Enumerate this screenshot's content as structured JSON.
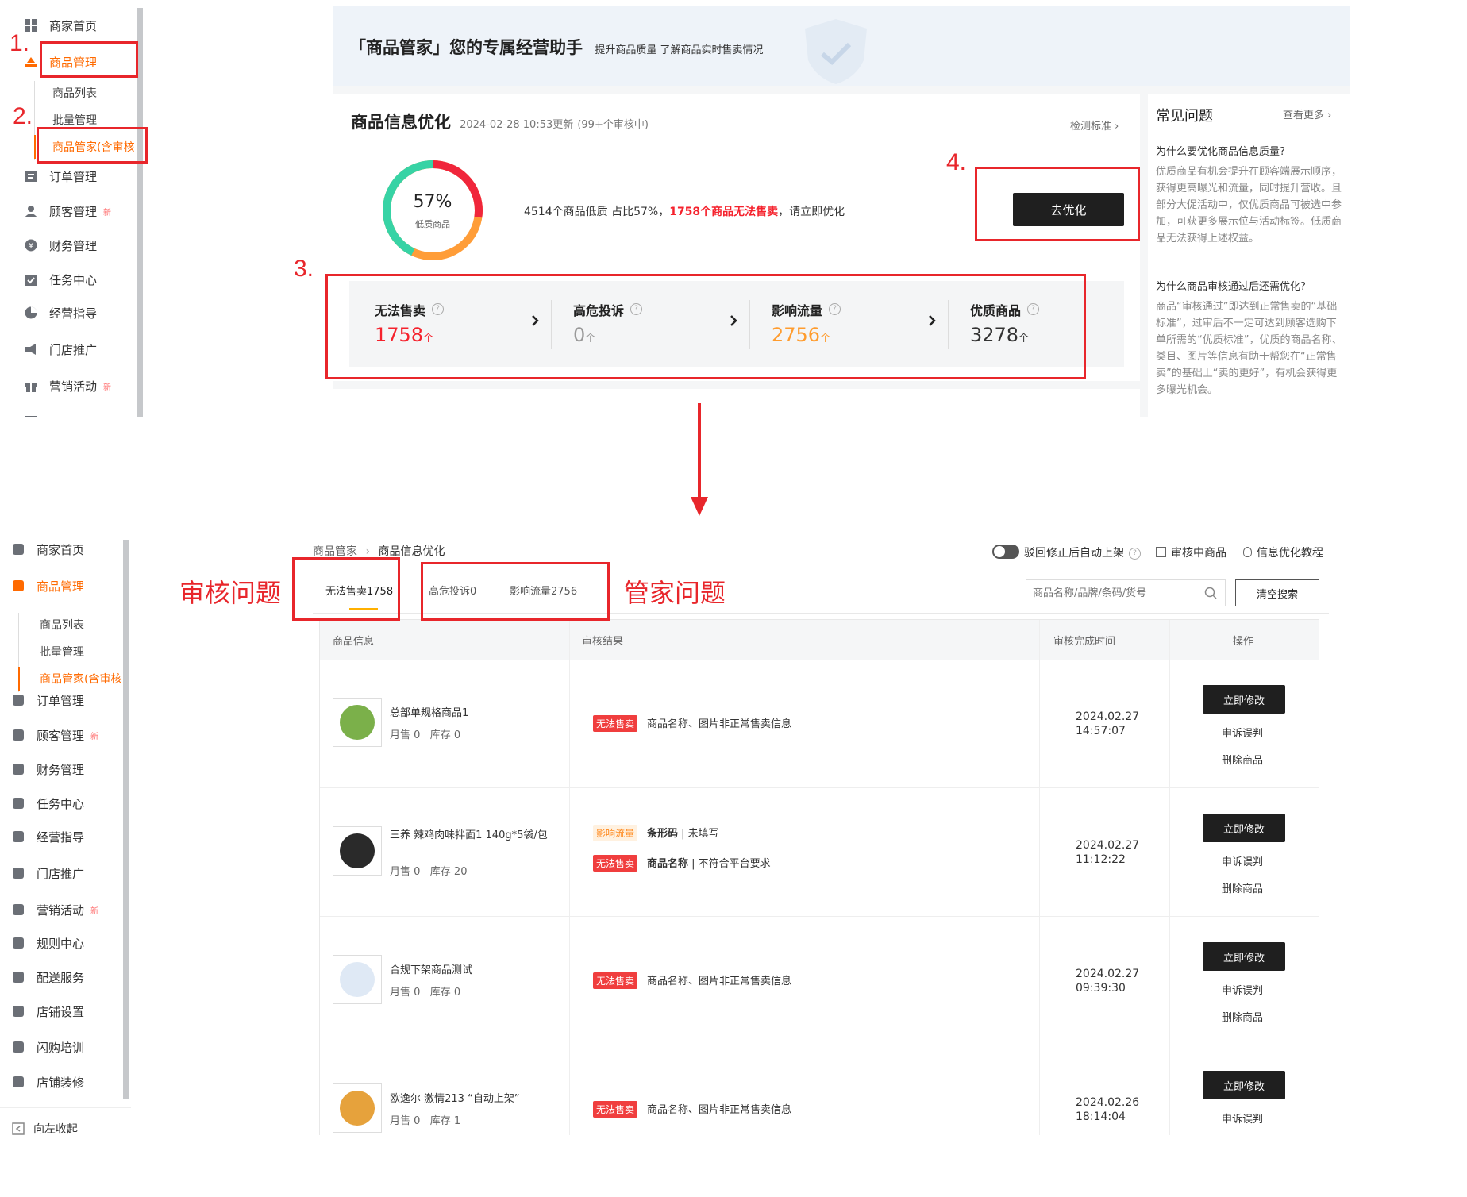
{
  "sidebar": {
    "items": [
      {
        "label": "商家首页"
      },
      {
        "label": "商品管理"
      },
      {
        "label": "订单管理"
      },
      {
        "label": "顾客管理",
        "badge": "新"
      },
      {
        "label": "财务管理"
      },
      {
        "label": "任务中心"
      },
      {
        "label": "经营指导"
      },
      {
        "label": "门店推广"
      },
      {
        "label": "营销活动",
        "badge": "新"
      },
      {
        "label": "规则中心"
      },
      {
        "label": "配送服务"
      },
      {
        "label": "店铺设置"
      },
      {
        "label": "闪购培训"
      },
      {
        "label": "店铺装修"
      }
    ],
    "sub_items": [
      {
        "label": "商品列表"
      },
      {
        "label": "批量管理"
      },
      {
        "label": "商品管家(含审核"
      }
    ],
    "collapse_label": "向左收起"
  },
  "annotations": {
    "num1": "1.",
    "num2": "2.",
    "num3": "3.",
    "num4": "4.",
    "audit_label": "审核问题",
    "butler_label": "管家问题"
  },
  "top": {
    "banner": {
      "title": "「商品管家」您的专属经营助手",
      "subtitle": "提升商品质量 了解商品实时售卖情况"
    },
    "optimize": {
      "title": "商品信息优化",
      "update_time": "2024-02-28 10:53更新",
      "pending_prefix": "(99+个",
      "pending_link": "审核中",
      "pending_suffix": ")",
      "detect_link": "检测标准 ›",
      "donut_percent": "57%",
      "donut_label": "低质商品",
      "donut_fraction": 0.57,
      "summary_pre": "4514个商品低质 占比57%，",
      "summary_red": "1758个商品无法售卖",
      "summary_post": "，请立即优化",
      "btn_optimize": "去优化",
      "stats": [
        {
          "label": "无法售卖",
          "value": "1758",
          "unit": "个",
          "color": "#f5222d"
        },
        {
          "label": "高危投诉",
          "value": "0",
          "unit": "个",
          "color": "#999999"
        },
        {
          "label": "影响流量",
          "value": "2756",
          "unit": "个",
          "color": "#ff9c2e"
        },
        {
          "label": "优质商品",
          "value": "3278",
          "unit": "个",
          "color": "#333333"
        }
      ]
    },
    "faq": {
      "title": "常见问题",
      "more": "查看更多 ›",
      "q1": "为什么要优化商品信息质量?",
      "a1": "优质商品有机会提升在顾客端展示顺序，获得更高曝光和流量，同时提升营收。且部分大促活动中，仅优质商品可被选中参加，可获更多展示位与活动标签。低质商品无法获得上述权益。",
      "q2": "为什么商品审核通过后还需优化?",
      "a2": "商品“审核通过”即达到正常售卖的“基础标准”，过审后不一定可达到顾客选购下单所需的“优质标准”，优质的商品名称、类目、图片等信息有助于帮您在“正常售卖”的基础上“卖的更好”，有机会获得更多曝光机会。"
    }
  },
  "bottom": {
    "breadcrumb": [
      "商品管家",
      "商品信息优化"
    ],
    "toggle_label": "驳回修正后自动上架",
    "audit_link": "审核中商品",
    "tutorial_link": "信息优化教程",
    "tabs": [
      {
        "label": "无法售卖1758"
      },
      {
        "label": "高危投诉0"
      },
      {
        "label": "影响流量2756"
      }
    ],
    "search_placeholder": "商品名称/品牌/条码/货号",
    "clear_btn": "清空搜索",
    "columns": [
      "商品信息",
      "审核结果",
      "审核完成时间",
      "操作"
    ],
    "rows": [
      {
        "name": "总部单规格商品1",
        "stats": "月售 0   库存 0",
        "issues": [
          {
            "tag": "无法售卖",
            "type": "red",
            "text": "商品名称、图片非正常售卖信息",
            "bold": ""
          }
        ],
        "date": "2024.02.27",
        "time": "14:57:07"
      },
      {
        "name": "三养 辣鸡肉味拌面1 140g*5袋/包",
        "stats": "月售 0   库存 20",
        "issues": [
          {
            "tag": "影响流量",
            "type": "orange",
            "text": " | 未填写",
            "bold": "条形码"
          },
          {
            "tag": "无法售卖",
            "type": "red",
            "text": " | 不符合平台要求",
            "bold": "商品名称"
          }
        ],
        "date": "2024.02.27",
        "time": "11:12:22"
      },
      {
        "name": "合规下架商品测试",
        "stats": "月售 0   库存 0",
        "issues": [
          {
            "tag": "无法售卖",
            "type": "red",
            "text": "商品名称、图片非正常售卖信息",
            "bold": ""
          }
        ],
        "date": "2024.02.27",
        "time": "09:39:30"
      },
      {
        "name": "欧逸尔 激情213 “自动上架”",
        "stats": "月售 0   库存 1",
        "issues": [
          {
            "tag": "无法售卖",
            "type": "red",
            "text": "商品名称、图片非正常售卖信息",
            "bold": ""
          }
        ],
        "date": "2024.02.26",
        "time": "18:14:04"
      }
    ],
    "actions": {
      "edit": "立即修改",
      "appeal": "申诉误判",
      "delete": "删除商品"
    }
  },
  "colors": {
    "accent": "#ff6a00",
    "annotation": "#e8262b",
    "danger": "#f5222d",
    "warning": "#ff9c2e",
    "dark_button": "#1f1f1f"
  }
}
